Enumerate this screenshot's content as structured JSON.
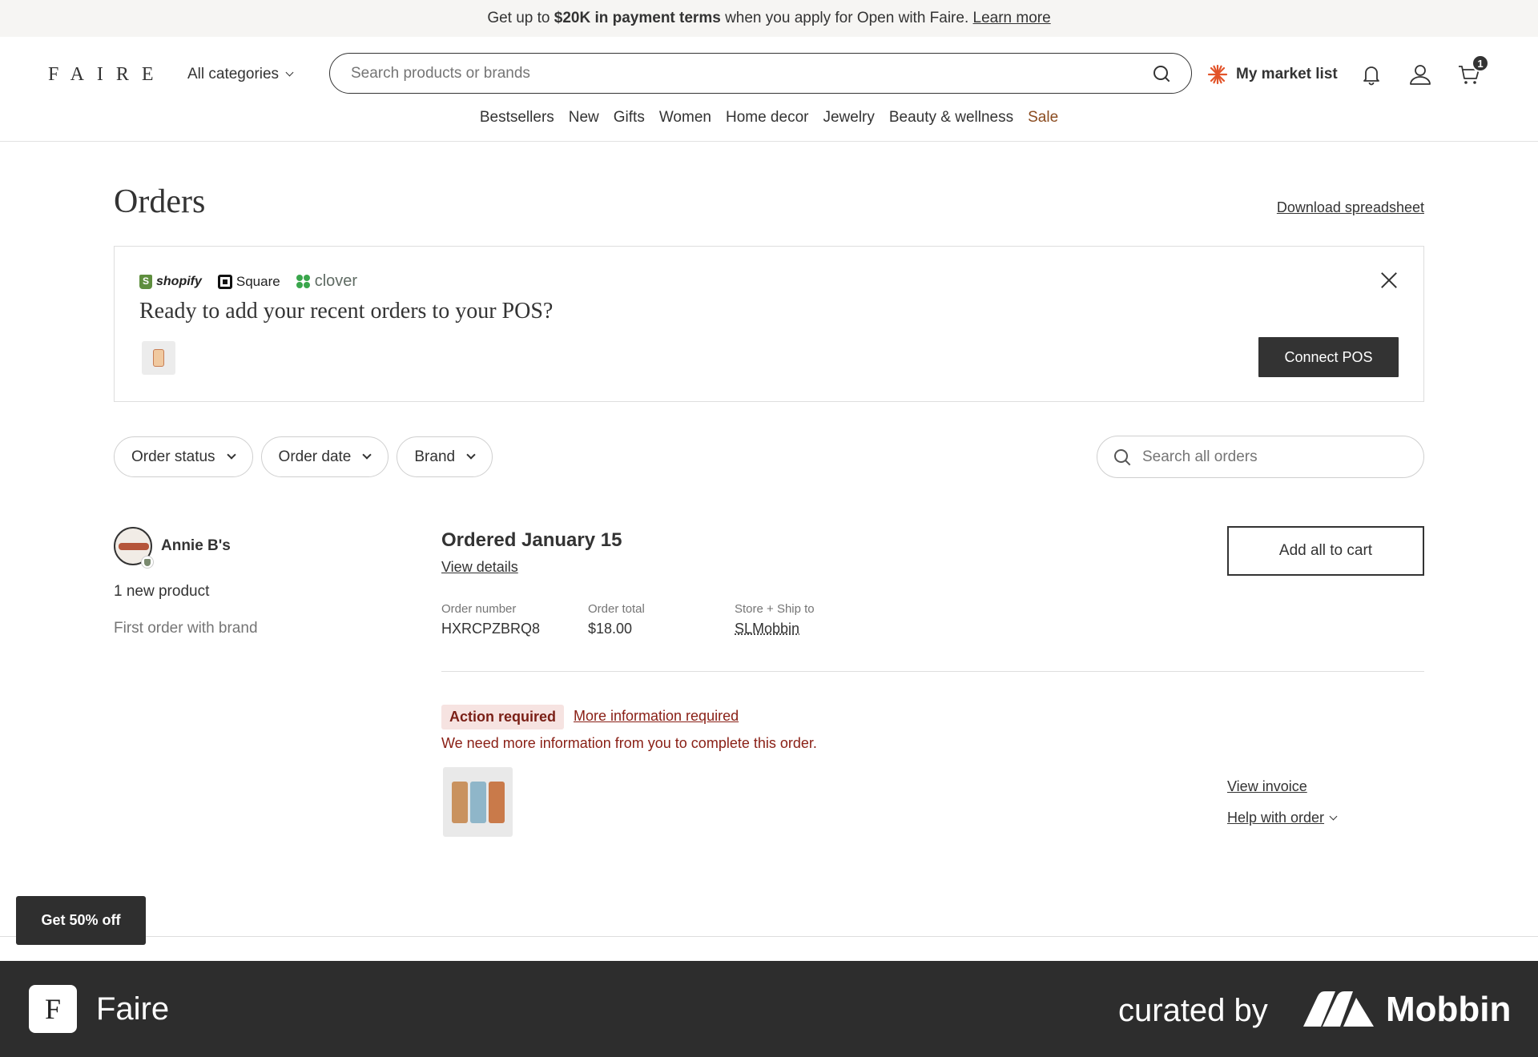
{
  "promo": {
    "prefix": "Get up to ",
    "bold": "$20K in payment terms",
    "suffix": " when you apply for Open with Faire. ",
    "link": "Learn more"
  },
  "header": {
    "logo": "FAIRE",
    "all_categories": "All categories",
    "search_placeholder": "Search products or brands",
    "market_list": "My market list",
    "cart_count": "1"
  },
  "nav": {
    "items": [
      "Bestsellers",
      "New",
      "Gifts",
      "Women",
      "Home decor",
      "Jewelry",
      "Beauty & wellness",
      "Sale"
    ]
  },
  "page": {
    "title": "Orders",
    "download": "Download spreadsheet"
  },
  "pos_card": {
    "logos": {
      "shopify": "shopify",
      "square": "Square",
      "clover": "clover"
    },
    "question": "Ready to add your recent orders to your POS?",
    "connect_label": "Connect POS"
  },
  "filters": {
    "order_status": "Order status",
    "order_date": "Order date",
    "brand": "Brand",
    "search_placeholder": "Search all orders"
  },
  "order": {
    "brand_name": "Annie B's",
    "new_products": "1 new product",
    "first_order": "First order with brand",
    "ordered_label": "Ordered January 15",
    "view_details": "View details",
    "order_number_label": "Order number",
    "order_number": "HXRCPZBRQ8",
    "order_total_label": "Order total",
    "order_total": "$18.00",
    "ship_to_label": "Store + Ship to",
    "ship_to": "SLMobbin",
    "add_all": "Add all to cart",
    "action_badge": "Action required",
    "more_info": "More information required",
    "need_info": "We need more information from you to complete this order.",
    "view_invoice": "View invoice",
    "help_order": "Help with order"
  },
  "promo_popup": {
    "label": "Get 50% off"
  },
  "footer": {
    "logo_letter": "F",
    "app_name": "Faire",
    "curated_by": "curated by",
    "mobbin": "Mobbin"
  },
  "colors": {
    "dark": "#333333",
    "sale": "#8a4b1f",
    "alert": "#8a2016",
    "alert_bg": "#f6e3e1",
    "footer_bg": "#2d2d2d"
  },
  "icons": [
    "search-icon",
    "sparkle-icon",
    "bell-icon",
    "user-icon",
    "cart-icon",
    "close-icon",
    "chevron-down-icon"
  ]
}
